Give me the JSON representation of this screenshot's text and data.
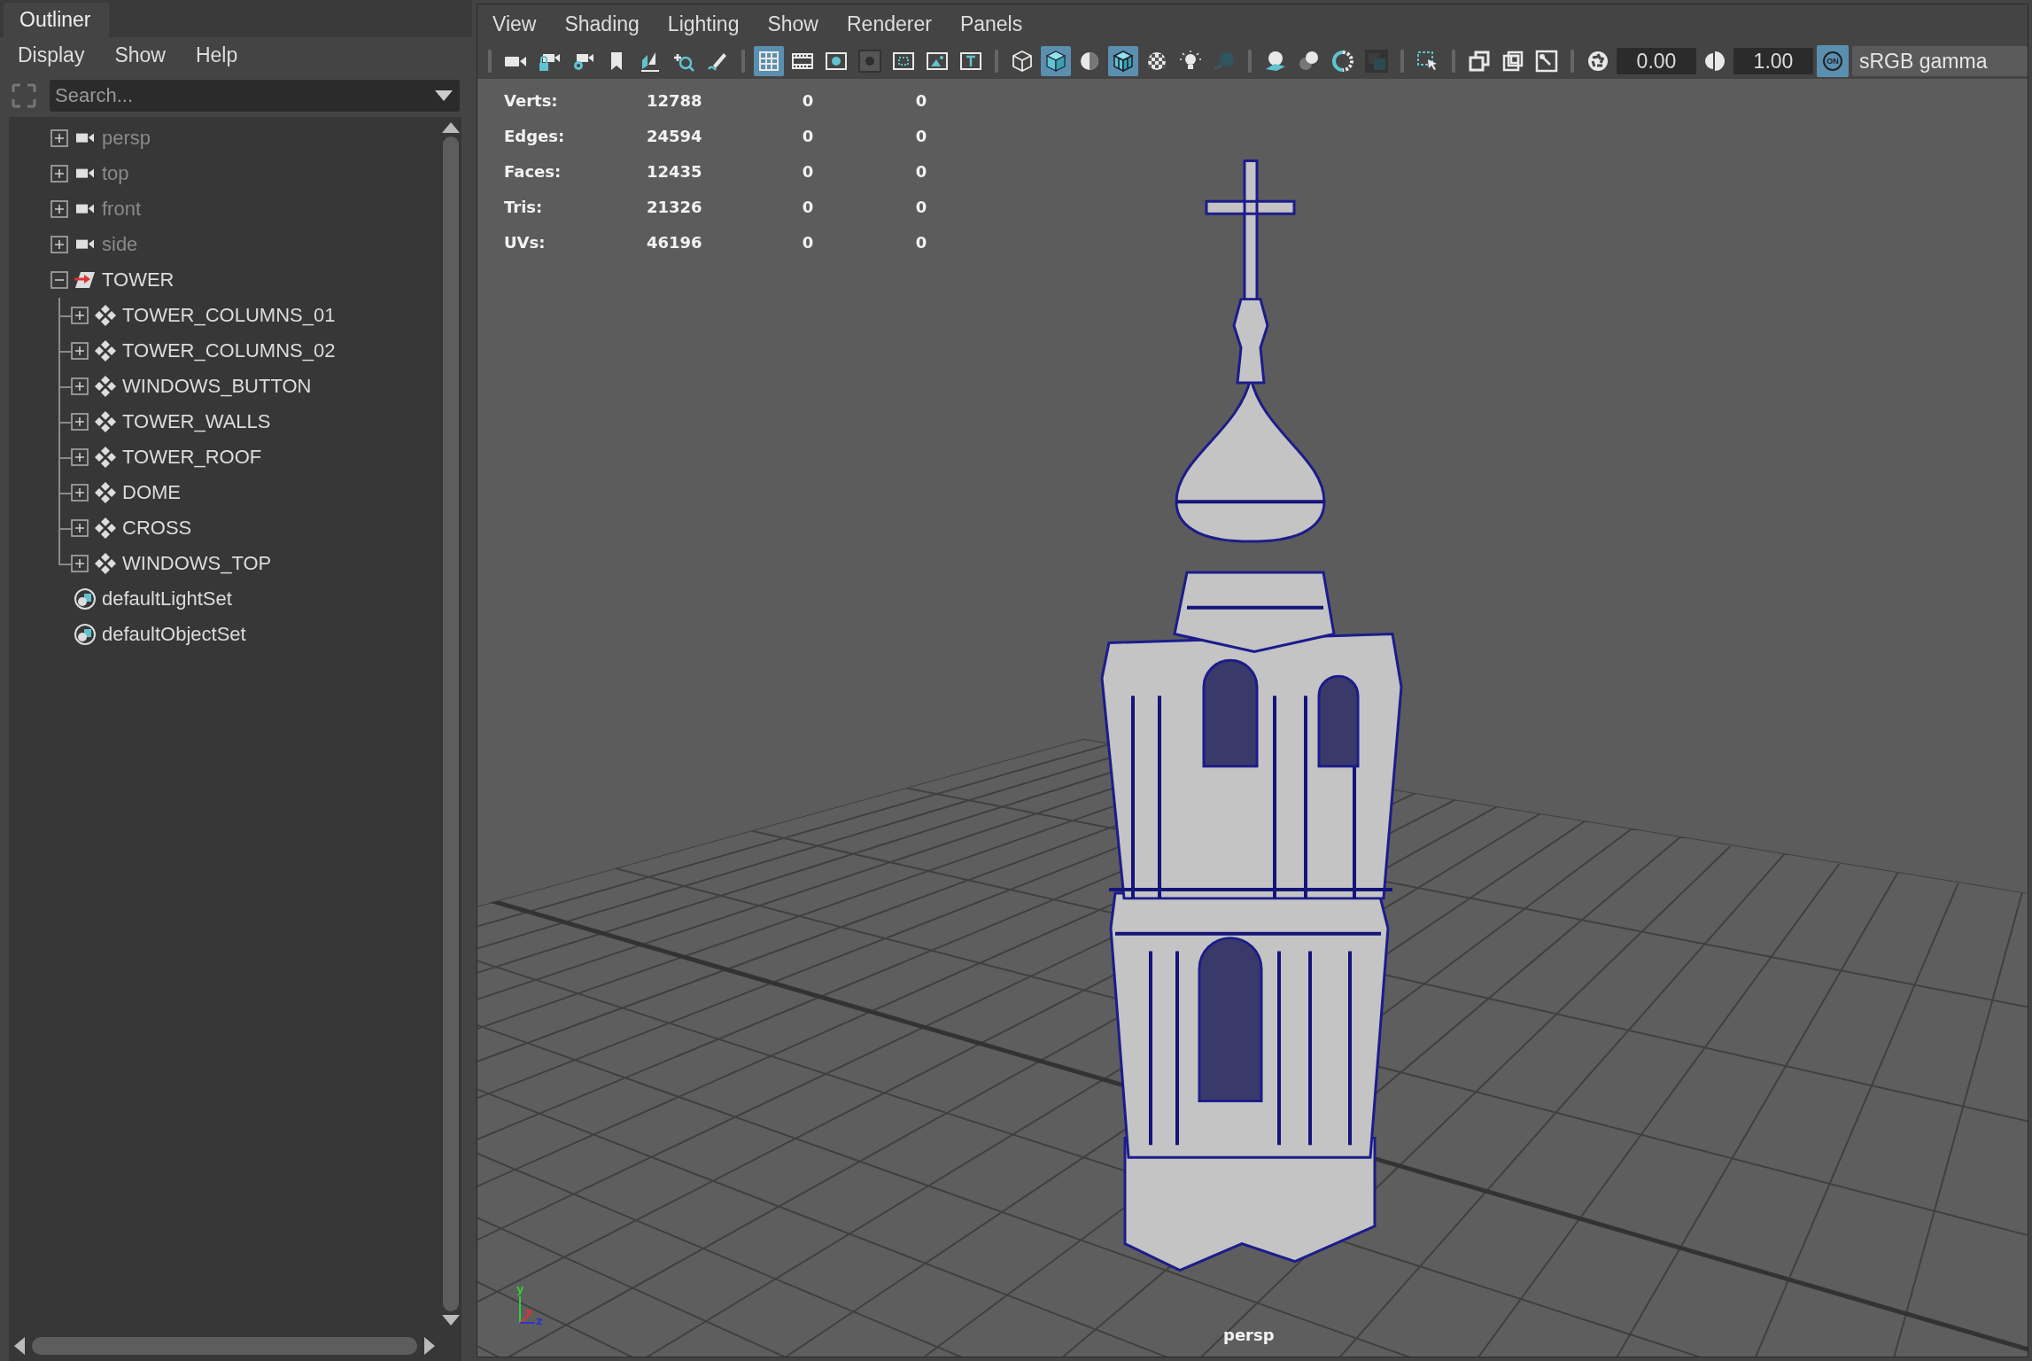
{
  "outliner": {
    "title": "Outliner",
    "menus": [
      "Display",
      "Show",
      "Help"
    ],
    "search": {
      "placeholder": "Search..."
    },
    "items": [
      {
        "label": "persp",
        "kind": "camera",
        "expanded": false,
        "dimmed": true
      },
      {
        "label": "top",
        "kind": "camera",
        "expanded": false,
        "dimmed": true
      },
      {
        "label": "front",
        "kind": "camera",
        "expanded": false,
        "dimmed": true
      },
      {
        "label": "side",
        "kind": "camera",
        "expanded": false,
        "dimmed": true
      },
      {
        "label": "TOWER",
        "kind": "group",
        "expanded": true,
        "dimmed": false,
        "children": [
          {
            "label": "TOWER_COLUMNS_01",
            "kind": "mesh",
            "expanded": false,
            "dimmed": false
          },
          {
            "label": "TOWER_COLUMNS_02",
            "kind": "mesh",
            "expanded": false,
            "dimmed": false
          },
          {
            "label": "WINDOWS_BUTTON",
            "kind": "mesh",
            "expanded": false,
            "dimmed": false
          },
          {
            "label": "TOWER_WALLS",
            "kind": "mesh",
            "expanded": false,
            "dimmed": false
          },
          {
            "label": "TOWER_ROOF",
            "kind": "mesh",
            "expanded": false,
            "dimmed": false
          },
          {
            "label": "DOME",
            "kind": "mesh",
            "expanded": false,
            "dimmed": false
          },
          {
            "label": "CROSS",
            "kind": "mesh",
            "expanded": false,
            "dimmed": false
          },
          {
            "label": "WINDOWS_TOP",
            "kind": "mesh",
            "expanded": false,
            "dimmed": false
          }
        ]
      },
      {
        "label": "defaultLightSet",
        "kind": "set",
        "dimmed": false
      },
      {
        "label": "defaultObjectSet",
        "kind": "set",
        "dimmed": false
      }
    ]
  },
  "viewport": {
    "menus": [
      "View",
      "Shading",
      "Lighting",
      "Show",
      "Renderer",
      "Panels"
    ],
    "toolbar": {
      "groups": [
        [
          {
            "selected": false
          },
          {
            "selected": false
          },
          {
            "selected": false
          },
          {
            "selected": false
          },
          {
            "selected": false
          },
          {
            "selected": false
          },
          {
            "selected": false
          }
        ],
        [
          {
            "selected": true
          },
          {
            "selected": false
          },
          {
            "selected": false
          },
          {
            "selected": false
          },
          {
            "selected": false
          },
          {
            "selected": false
          },
          {
            "selected": false
          }
        ],
        [
          {
            "selected": false
          },
          {
            "selected": true
          },
          {
            "selected": false
          },
          {
            "selected": true
          },
          {
            "selected": false
          },
          {
            "selected": false
          },
          {
            "selected": false
          }
        ],
        [
          {
            "selected": false
          },
          {
            "selected": false
          },
          {
            "selected": false
          },
          {
            "selected": false
          }
        ],
        [
          {
            "selected": false
          }
        ],
        [
          {
            "selected": false
          },
          {
            "selected": false
          },
          {
            "selected": false
          }
        ]
      ],
      "exposure": "0.00",
      "gamma": "1.00",
      "color_management": {
        "label": "ON",
        "on": true
      },
      "view_transform": "sRGB gamma"
    },
    "hud": [
      {
        "label": "Verts:",
        "values": [
          "12788",
          "0",
          "0"
        ]
      },
      {
        "label": "Edges:",
        "values": [
          "24594",
          "0",
          "0"
        ]
      },
      {
        "label": "Faces:",
        "values": [
          "12435",
          "0",
          "0"
        ]
      },
      {
        "label": "Tris:",
        "values": [
          "21326",
          "0",
          "0"
        ]
      },
      {
        "label": "UVs:",
        "values": [
          "46196",
          "0",
          "0"
        ]
      }
    ],
    "axes": [
      "y",
      "x",
      "z"
    ],
    "camera": "persp"
  }
}
